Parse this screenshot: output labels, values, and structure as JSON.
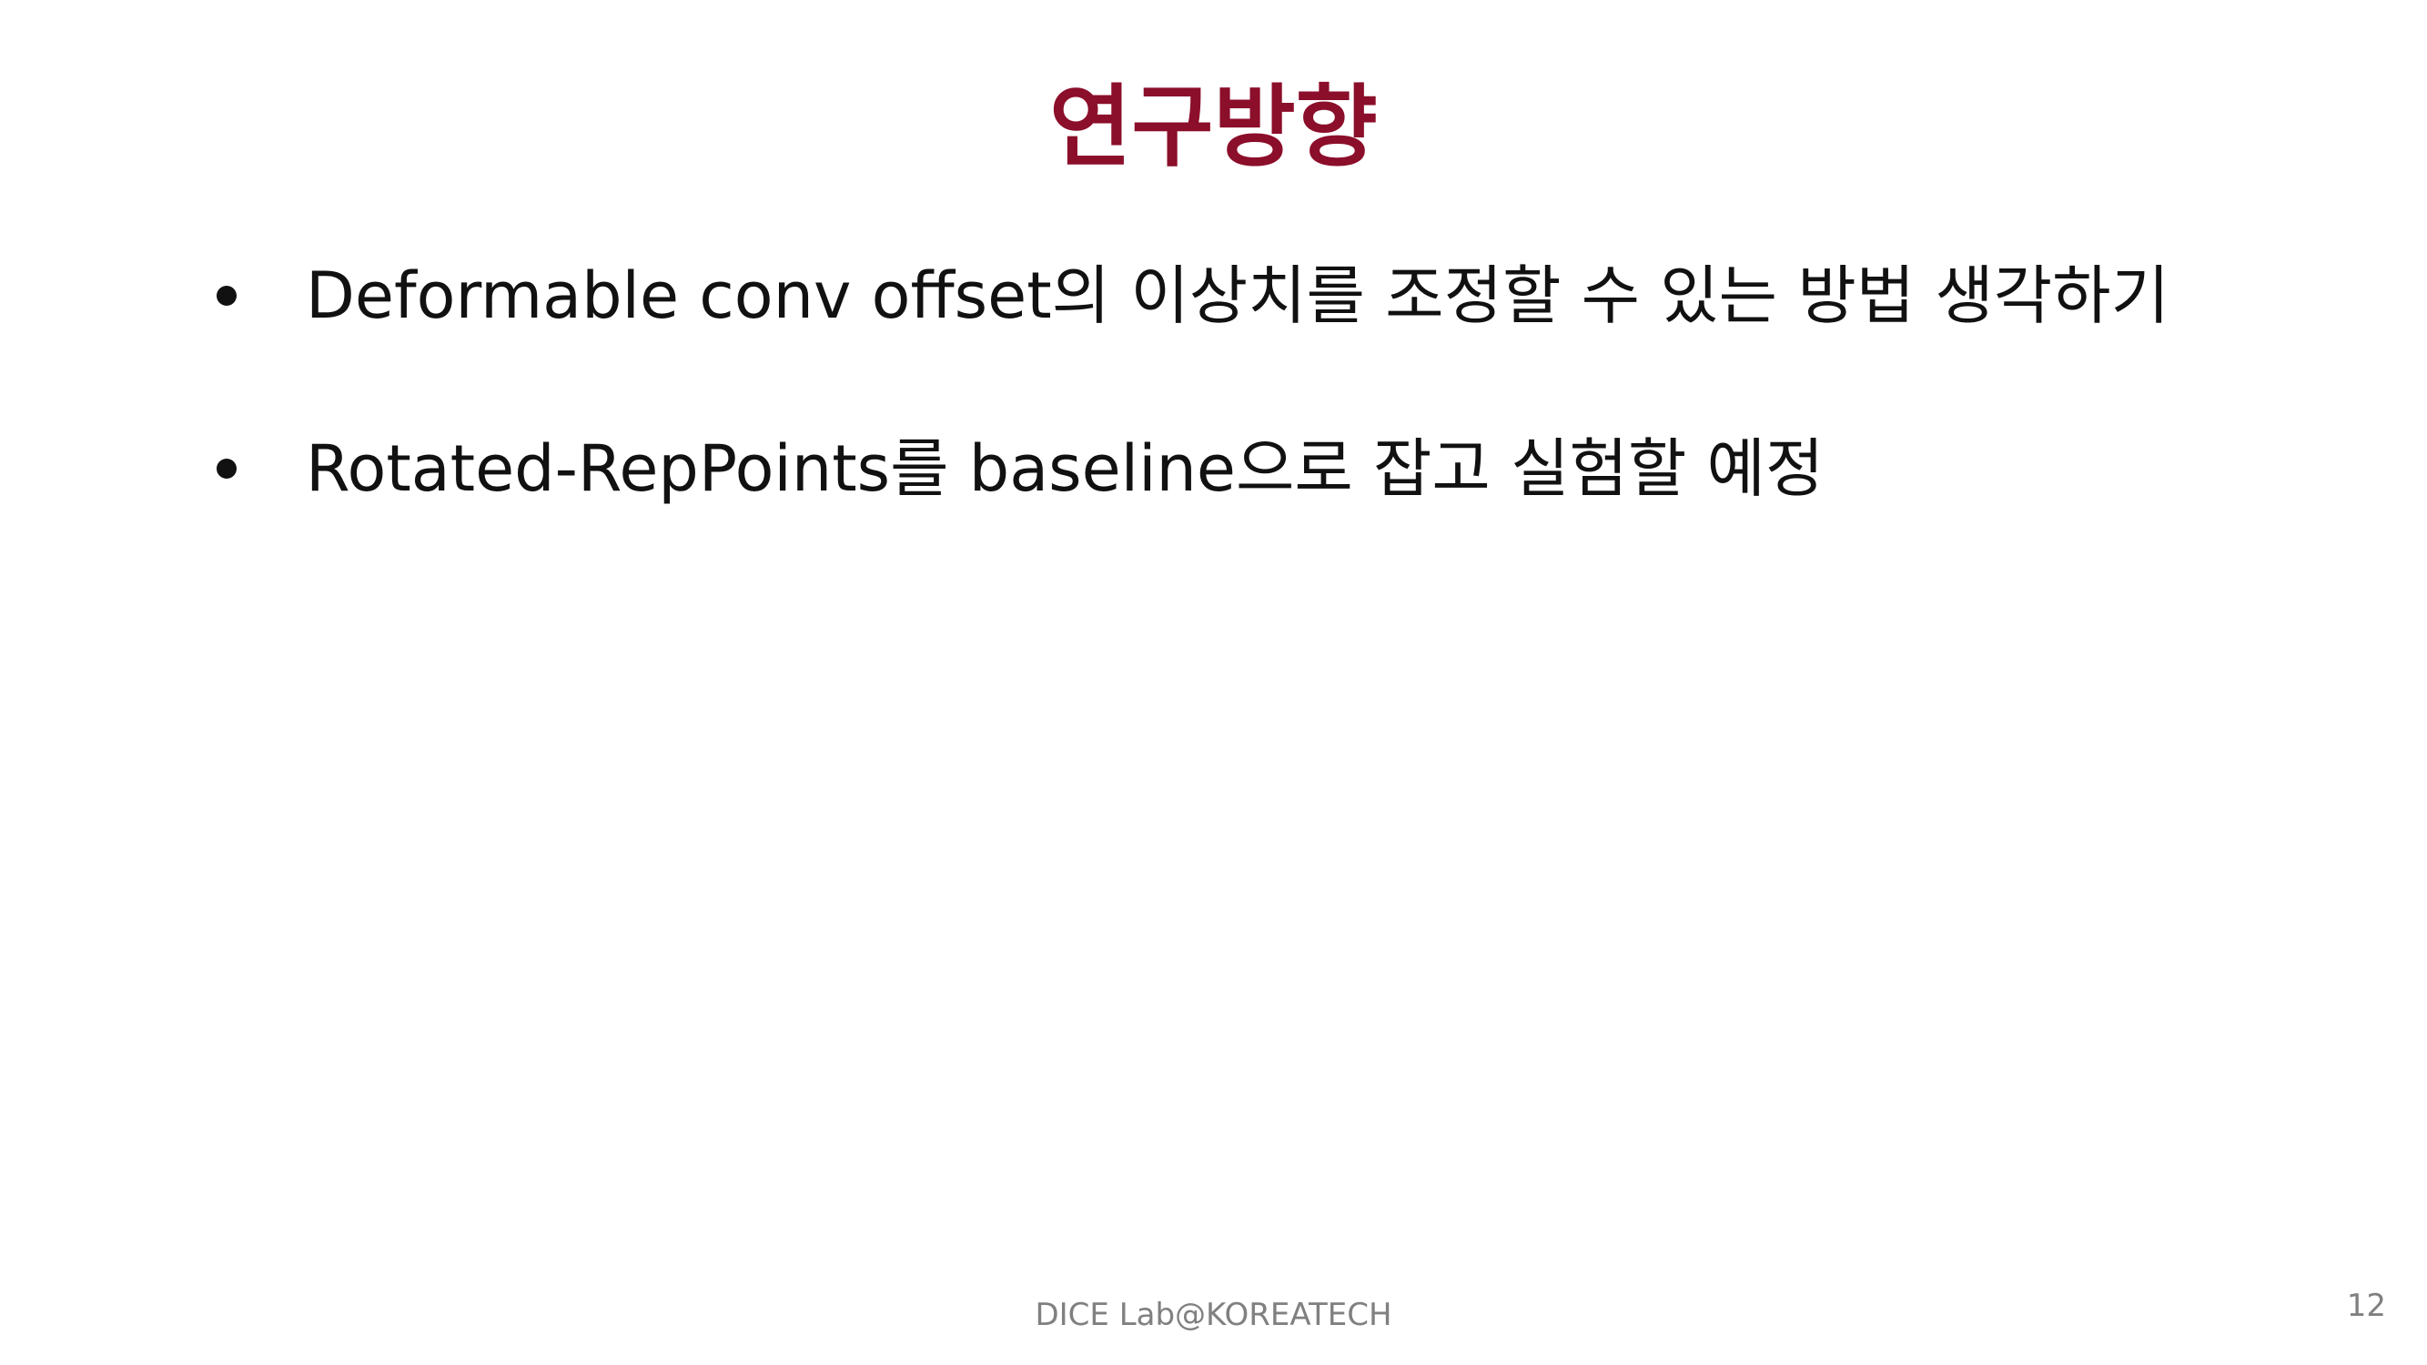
{
  "slide": {
    "title": "연구방향",
    "bullets": [
      {
        "text": "Deformable conv offset의 이상치를 조정할 수 있는 방법 생각하기"
      },
      {
        "text": "Rotated-RepPoints를 baseline으로 잡고 실험할 예정"
      }
    ],
    "footer": "DICE Lab@KOREATECH",
    "page_number": "12"
  },
  "colors": {
    "title": "#8B0E2A",
    "body_text": "#111111",
    "footer_text": "#808080",
    "background": "#ffffff"
  }
}
